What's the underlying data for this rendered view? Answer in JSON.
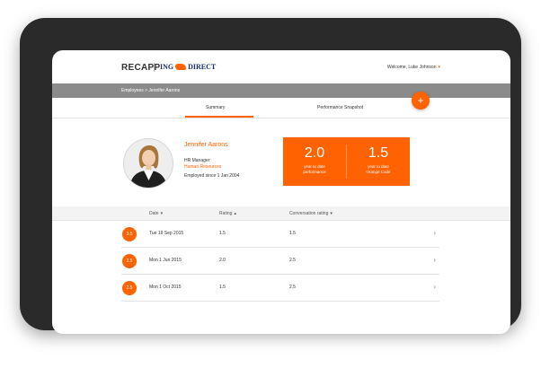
{
  "header": {
    "app_name": "RECAPP",
    "brand": {
      "left": "ING",
      "right": "DIRECT"
    },
    "welcome": "Welcome, Luke Johnson",
    "welcome_caret": "▾"
  },
  "breadcrumb": "Employees > Jennifer Aarons",
  "fab_label": "+",
  "tabs": [
    {
      "label": "Summary",
      "active": true
    },
    {
      "label": "Performance Snapshot",
      "active": false
    }
  ],
  "profile": {
    "name": "Jennifer Aarons",
    "role": "HR Manager",
    "department": "Human Resources",
    "employed_since": "Employed since 1 Jan 2004"
  },
  "stats": [
    {
      "value": "2.0",
      "label_line1": "year to date",
      "label_line2": "performance"
    },
    {
      "value": "1.5",
      "label_line1": "year to date",
      "label_line2": "Orange Code"
    }
  ],
  "table": {
    "columns": [
      {
        "label": "Date",
        "sort": "▾"
      },
      {
        "label": "Rating",
        "sort": "▴"
      },
      {
        "label": "Conversation rating",
        "sort": "▾"
      }
    ],
    "rows": [
      {
        "score": "3.5",
        "date": "Tue 19 Sep 2015",
        "rating": "1.5",
        "conversation": "1.5"
      },
      {
        "score": "2.5",
        "date": "Mon 1 Jun 2015",
        "rating": "2.0",
        "conversation": "2.5"
      },
      {
        "score": "2.5",
        "date": "Mon 1 Oct 2015",
        "rating": "1.5",
        "conversation": "2.5"
      }
    ]
  },
  "colors": {
    "accent": "#ff6200",
    "breadcrumb_bg": "#8b8b8b",
    "device": "#2a2a2a",
    "brand_blue": "#17306b"
  },
  "icons": {
    "avatar": "user-photo",
    "row_chevron": "chevron-right-icon"
  }
}
